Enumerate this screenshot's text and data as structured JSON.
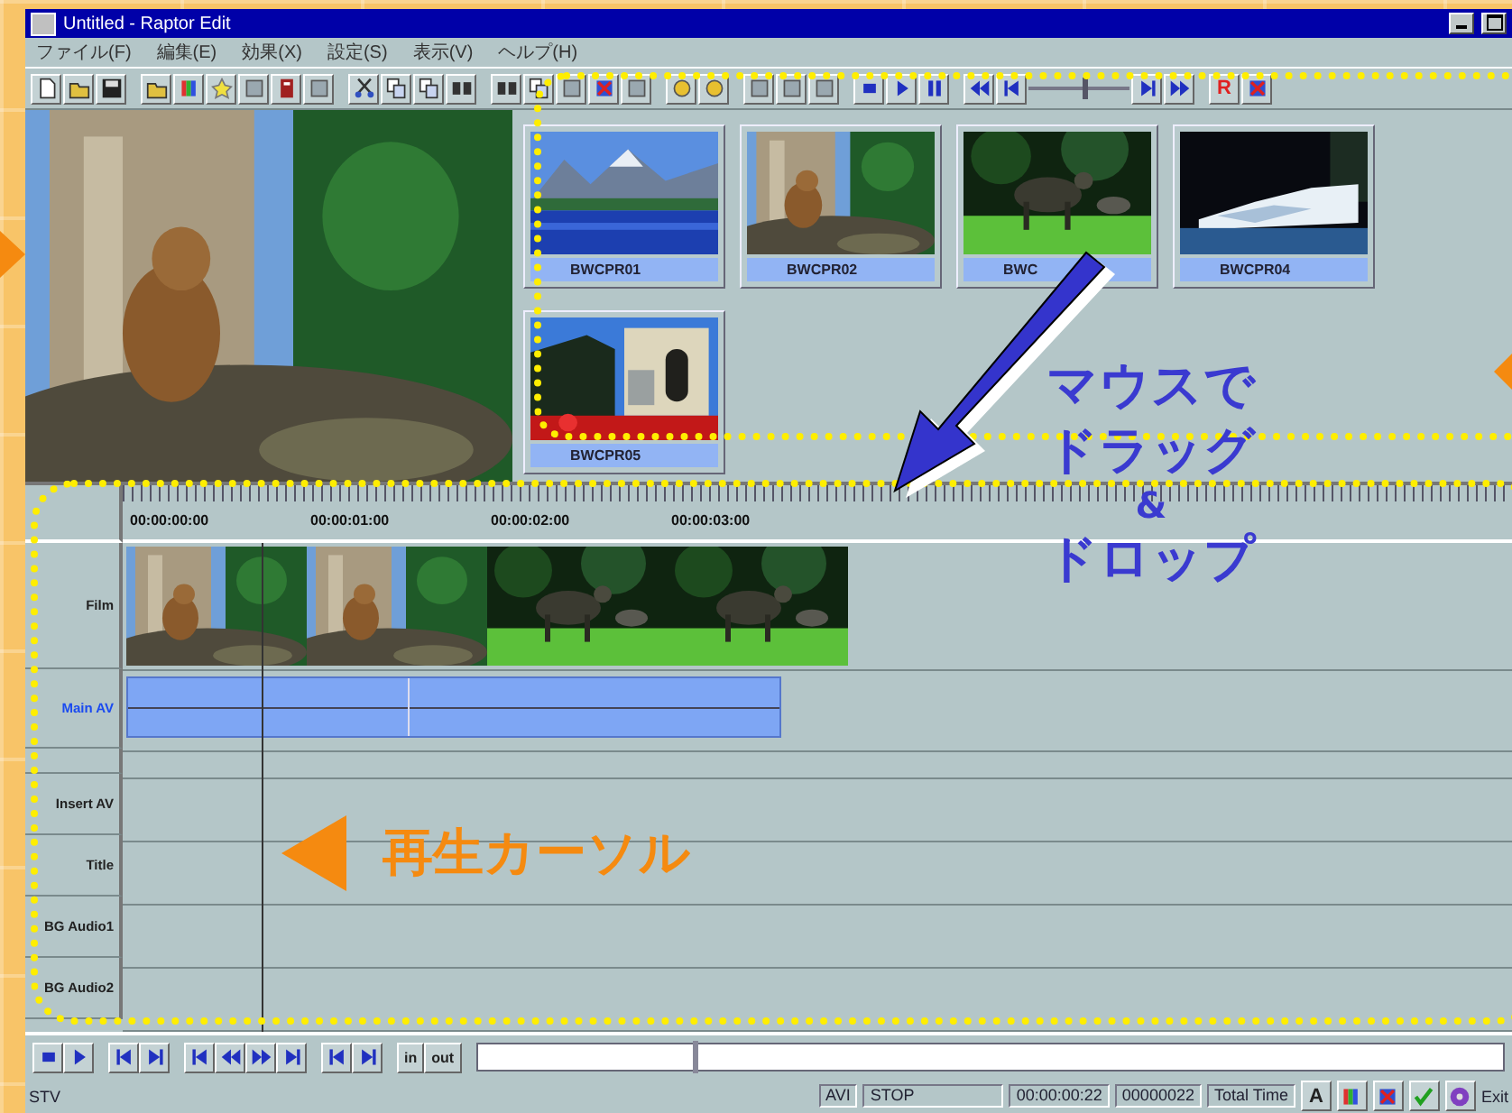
{
  "window": {
    "title": "Untitled - Raptor Edit"
  },
  "menu": [
    {
      "label": "ファイル(F)"
    },
    {
      "label": "編集(E)"
    },
    {
      "label": "効果(X)"
    },
    {
      "label": "設定(S)"
    },
    {
      "label": "表示(V)"
    },
    {
      "label": "ヘルプ(H)"
    }
  ],
  "toolbar": {
    "record_label": "R",
    "slider": {
      "level": 0.55
    }
  },
  "clips": [
    {
      "name": "BWCPR01"
    },
    {
      "name": "BWCPR02"
    },
    {
      "name": "BWC"
    },
    {
      "name": "BWCPR04"
    },
    {
      "name": "BWCPR05"
    }
  ],
  "timeline": {
    "timecodes": [
      "00:00:00:00",
      "00:00:01:00",
      "00:00:02:00",
      "00:00:03:00"
    ],
    "playhead": {
      "level": 0.1
    },
    "tracks": [
      {
        "label": "Film",
        "kind": "film",
        "selected": false
      },
      {
        "label": "Main AV",
        "kind": "clip",
        "selected": true
      },
      {
        "kind": "spacer"
      },
      {
        "label": "Insert AV",
        "kind": "empty",
        "selected": false
      },
      {
        "label": "Title",
        "kind": "empty",
        "selected": false
      },
      {
        "label": "BG Audio1",
        "kind": "empty",
        "selected": false
      },
      {
        "label": "BG Audio2",
        "kind": "empty",
        "selected": false
      }
    ]
  },
  "annotations": {
    "drag_lines": [
      "マウスで",
      "ドラッグ",
      "&",
      "ドロップ"
    ],
    "cursor_text": "再生カーソル"
  },
  "transport": {
    "in_label": "in",
    "out_label": "out",
    "seek": {
      "level": 0.21
    }
  },
  "status_bar": {
    "left": "STV",
    "format": "AVI",
    "state": "STOP",
    "timecode": "00:00:00:22",
    "frames": "00000022",
    "total_label": "Total Time",
    "font_label": "A",
    "exit_label": "Exit"
  }
}
